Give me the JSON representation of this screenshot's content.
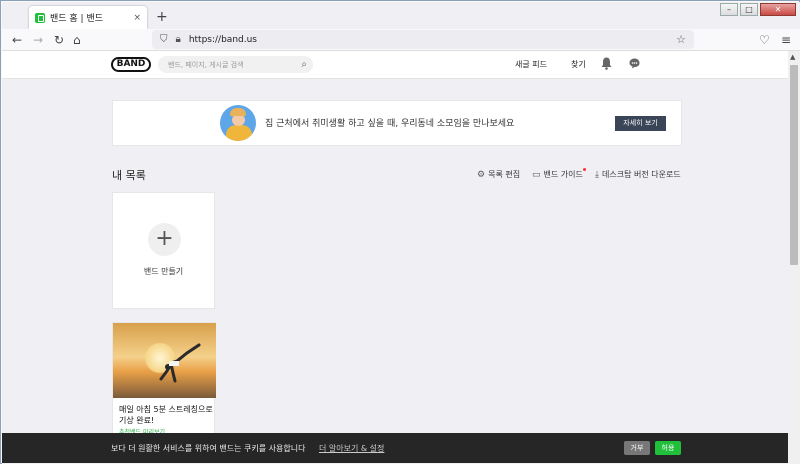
{
  "browser": {
    "tab_title": "밴드 홈 | 밴드",
    "tab_close": "×",
    "new_tab": "+",
    "url": "https://band.us",
    "window_buttons": {
      "minimize": "–",
      "maximize": "□",
      "close": "✕"
    }
  },
  "header": {
    "logo": "BAND",
    "search_placeholder": "밴드, 페이지, 게시글 검색",
    "new_feed": "새글 피드",
    "find": "찾기"
  },
  "banner": {
    "text": "집 근처에서 취미생활 하고 싶을 때, 우리동네 소모임을 만나보세요",
    "button": "자세히 보기"
  },
  "section": {
    "title": "내 목록",
    "edit_list": "목록 편집",
    "band_guide": "밴드 가이드",
    "desktop_download": "데스크탑 버전 다운로드"
  },
  "cards": {
    "create_label": "밴드 만들기",
    "plus": "+",
    "band_title": "매일 아침 5분 스트레칭으로 기상 완료!",
    "band_sub": "추천밴드 미리보기"
  },
  "cookie": {
    "text": "보다 더 원활한 서비스를 위하여 밴드는 쿠키를 사용합니다",
    "link": "더 알아보기 & 설정",
    "reject": "거부",
    "accept": "허용"
  },
  "colors": {
    "brand_green": "#21c03a",
    "banner_button": "#3a4557",
    "cookie_bg": "#262626"
  },
  "icons": {
    "back": "arrow-left-icon",
    "forward": "arrow-right-icon",
    "reload": "reload-icon",
    "home": "home-icon",
    "shield": "shield-icon",
    "lock": "lock-icon",
    "star": "star-icon",
    "pocket": "pocket-icon",
    "menu": "menu-icon",
    "bell": "bell-icon",
    "chat": "chat-icon",
    "search": "search-icon",
    "gear": "gear-icon",
    "book": "book-icon",
    "download": "download-icon"
  }
}
